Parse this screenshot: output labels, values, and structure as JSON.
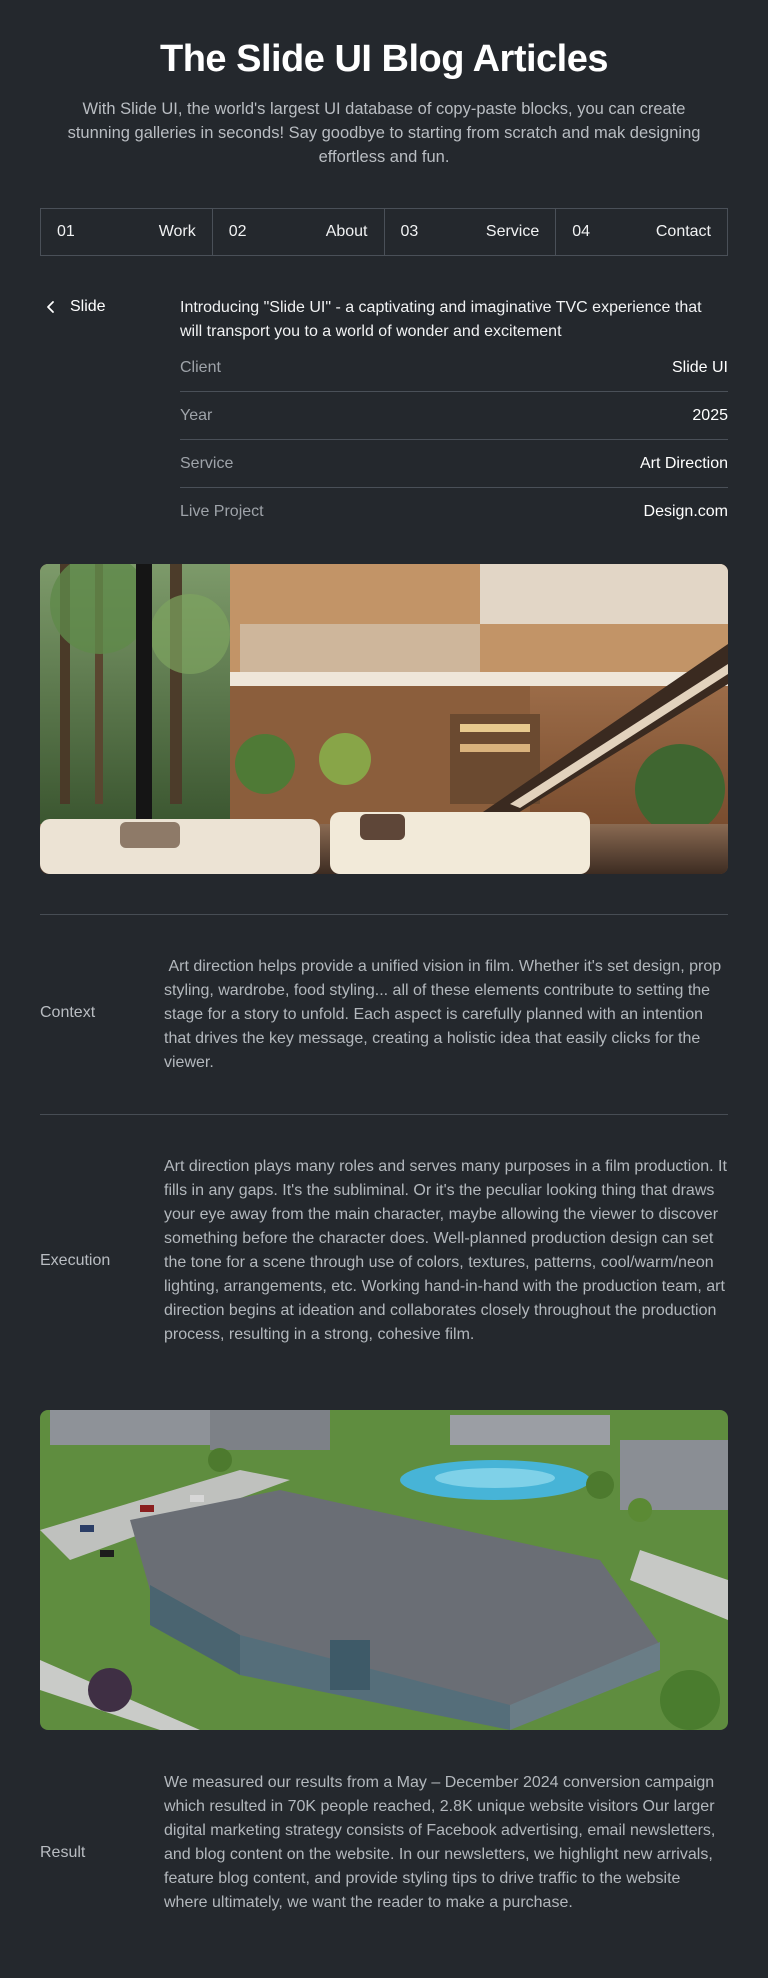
{
  "header": {
    "title": "The Slide UI Blog Articles",
    "subtitle": "With Slide UI, the world's largest UI database of copy-paste blocks, you can create stunning galleries in seconds! Say goodbye to starting from scratch and mak designing effortless and fun."
  },
  "tabs": [
    {
      "num": "01",
      "label": "Work"
    },
    {
      "num": "02",
      "label": "About"
    },
    {
      "num": "03",
      "label": "Service"
    },
    {
      "num": "04",
      "label": "Contact"
    }
  ],
  "back": {
    "label": "Slide",
    "icon": "chevron-left-icon"
  },
  "intro": "Introducing \"Slide UI\" - a captivating and imaginative TVC experience that will transport you to a world of wonder and excitement",
  "meta": [
    {
      "key": "Client",
      "value": "Slide UI"
    },
    {
      "key": "Year",
      "value": "2025"
    },
    {
      "key": "Service",
      "value": "Art Direction"
    },
    {
      "key": "Live Project",
      "value": "Design.com"
    }
  ],
  "sections": {
    "context": {
      "label": "Context",
      "text": " Art direction helps provide a unified vision in film. Whether it's set design, prop styling, wardrobe, food styling... all of these elements contribute to setting the stage for a story to unfold. Each aspect is carefully planned with an intention that drives the key message, creating a holistic idea that easily clicks for the viewer."
    },
    "execution": {
      "label": "Execution",
      "text": "Art direction plays many roles and serves many purposes in a film production. It fills in any gaps. It's the subliminal. Or it's the peculiar looking thing that draws your eye away from the main character, maybe allowing the viewer to discover something before the character does. Well-planned production design can set the tone for a scene through use of colors, textures, patterns, cool/warm/neon lighting, arrangements, etc. Working hand-in-hand with the production team, art direction begins at ideation and collaborates closely throughout the production process, resulting in a strong, cohesive film."
    },
    "result": {
      "label": "Result",
      "text": "We measured our results from a May – December 2024 conversion campaign which resulted in 70K people reached, 2.8K unique website visitors Our larger digital marketing strategy consists of Facebook advertising, email newsletters, and blog content on the website. In our newsletters, we highlight new arrivals, feature blog content, and provide styling tips to drive traffic to the website where ultimately, we want the reader to make a purchase."
    }
  },
  "colors": {
    "background": "#24282d",
    "border": "#4a5058",
    "text_primary": "#ffffff",
    "text_secondary": "#b3b8bd"
  }
}
